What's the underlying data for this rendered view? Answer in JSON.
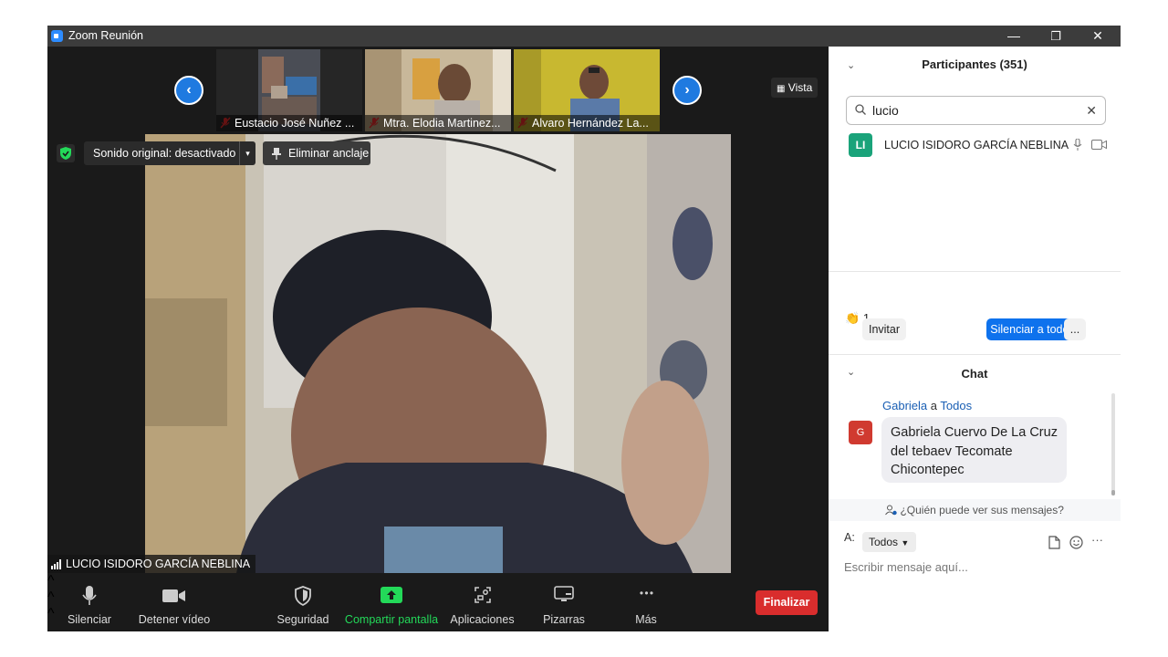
{
  "window": {
    "title": "Zoom Reunión",
    "minimize": "—",
    "restore": "❐",
    "close": "✕"
  },
  "thumbnails": [
    {
      "name": "Eustacio José Nuñez ..."
    },
    {
      "name": "Mtra. Elodia Martinez..."
    },
    {
      "name": "Alvaro Hernández La..."
    }
  ],
  "nav": {
    "prev": "‹",
    "next": "›"
  },
  "view_button": "Vista",
  "overlay": {
    "sound": "Sonido original: desactivado",
    "sound_caret": "▾",
    "unpin": "Eliminar anclaje"
  },
  "main_speaker": "LUCIO ISIDORO GARCÍA NEBLINA",
  "toolbar": {
    "mute": "Silenciar",
    "video": "Detener vídeo",
    "security": "Seguridad",
    "share": "Compartir pantalla",
    "apps": "Aplicaciones",
    "whiteboards": "Pizarras",
    "more": "Más",
    "end": "Finalizar",
    "caret": "^",
    "more_dots": "• • •"
  },
  "participants": {
    "title": "Participantes (351)",
    "search_value": "lucio",
    "clear": "✕",
    "collapse": "⌄",
    "rows": [
      {
        "initials": "LI",
        "name": "LUCIO ISIDORO GARCÍA NEBLINA"
      }
    ],
    "reactions": {
      "emoji": "👏",
      "count": "1"
    },
    "invite": "Invitar",
    "mute_all": "Silenciar a todos",
    "more": "..."
  },
  "chat": {
    "title": "Chat",
    "collapse": "⌄",
    "message": {
      "sender": "Gabriela",
      "connector": "a",
      "recipient": "Todos",
      "avatar": "G",
      "lines": [
        "Gabriela Cuervo De La Cruz",
        "del tebaev Tecomate",
        "Chicontepec"
      ]
    },
    "who_can_see": "¿Quién puede ver sus mensajes?",
    "to_label": "A:",
    "to_value": "Todos",
    "placeholder": "Escribir mensaje aquí...",
    "more": "···"
  },
  "colors": {
    "accent_blue": "#0e72ed",
    "share_green": "#23d959",
    "end_red": "#d92d2d",
    "avatar_green": "#1aa37a",
    "avatar_red": "#d03a30"
  }
}
